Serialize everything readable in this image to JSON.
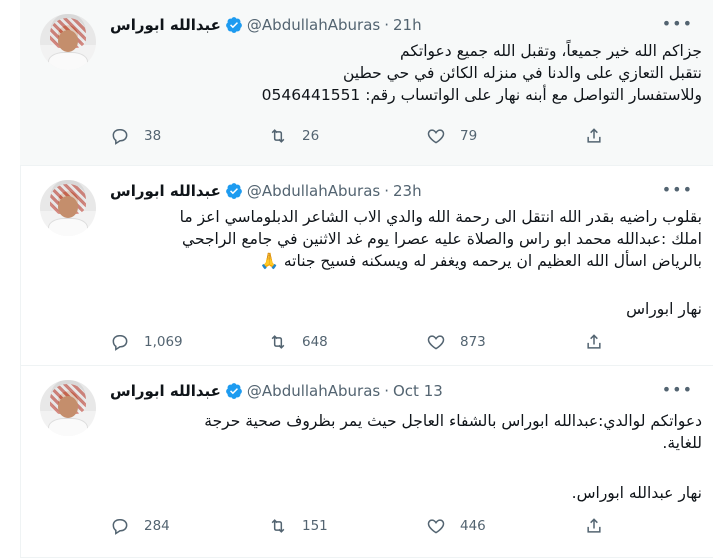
{
  "tweets": [
    {
      "name": "عبدالله ابوراس",
      "handle": "@AbdullahAburas",
      "separator": "·",
      "time": "21h",
      "lines": [
        "جزاكم الله خير جميعاً، وتقبل الله جميع دعواتكم",
        "نتقبل التعازي على والدنا في منزله الكائن في حي حطين",
        "وللاستفسار التواصل مع أبنه نهار على الواتساب رقم: 0546441551"
      ],
      "signature": "",
      "replies": "38",
      "retweets": "26",
      "likes": "79"
    },
    {
      "name": "عبدالله ابوراس",
      "handle": "@AbdullahAburas",
      "separator": "·",
      "time": "23h",
      "lines": [
        "بقلوب راضيه بقدر الله انتقل الى رحمة الله والدي الاب الشاعر الدبلوماسي اعز ما",
        "املك :عبدالله محمد ابو راس والصلاة عليه عصرا يوم غد الاثنين في جامع الراجحي",
        "بالرياض اسأل الله العظيم ان يرحمه ويغفر له ويسكنه فسيح جناته 🙏"
      ],
      "signature": "نهار ابوراس",
      "replies": "1,069",
      "retweets": "648",
      "likes": "873"
    },
    {
      "name": "عبدالله ابوراس",
      "handle": "@AbdullahAburas",
      "separator": "·",
      "time": "Oct 13",
      "lines": [
        "دعواتكم لوالدي:عبدالله ابوراس بالشفاء العاجل حيث يمر بظروف صحية حرجة",
        "للغاية."
      ],
      "signature": "نهار عبدالله ابوراس.",
      "replies": "284",
      "retweets": "151",
      "likes": "446"
    }
  ],
  "icons": {
    "more": "more-icon",
    "verified": "verified-badge-icon",
    "reply": "reply-icon",
    "retweet": "retweet-icon",
    "like": "heart-icon",
    "share": "share-icon"
  },
  "colors": {
    "verified": "#1d9bf0",
    "muted": "#536471",
    "text": "#0f1419",
    "highlight_bg": "#f7f9f9"
  }
}
